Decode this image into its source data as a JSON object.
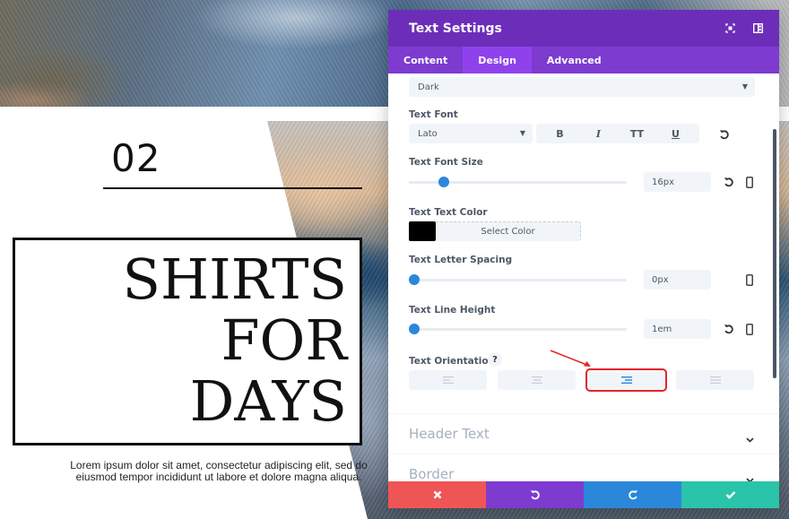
{
  "page": {
    "number": "02",
    "title_lines": [
      "SHIRTS",
      "FOR",
      "DAYS"
    ],
    "lorem_line1": "Lorem ipsum dolor sit amet, consectetur adipiscing elit, sed do",
    "lorem_line2": "eiusmod tempor incididunt ut labore et dolore magna aliqua."
  },
  "panel": {
    "title": "Text Settings",
    "header_icons": [
      "expand-icon",
      "split-view-icon"
    ],
    "tabs": [
      {
        "label": "Content",
        "active": false
      },
      {
        "label": "Design",
        "active": true
      },
      {
        "label": "Advanced",
        "active": false
      }
    ],
    "text_color_select": {
      "value": "Dark"
    },
    "text_font": {
      "label": "Text Font",
      "value": "Lato",
      "styles": [
        "B",
        "I",
        "TT",
        "U"
      ]
    },
    "text_font_size": {
      "label": "Text Font Size",
      "value": "16px",
      "slider_fraction": 0.16
    },
    "text_text_color": {
      "label": "Text Text Color",
      "swatch": "#000000",
      "button": "Select Color"
    },
    "text_letter_spacing": {
      "label": "Text Letter Spacing",
      "value": "0px",
      "slider_fraction": 0.0
    },
    "text_line_height": {
      "label": "Text Line Height",
      "value": "1em",
      "slider_fraction": 0.0
    },
    "text_orientation": {
      "label": "Text Orientation",
      "help": "?",
      "options": [
        "left",
        "center",
        "right",
        "justify"
      ],
      "selected": "right"
    },
    "sections": [
      {
        "title": "Header Text"
      },
      {
        "title": "Border"
      }
    ],
    "footer": {
      "cancel_color": "#ef5555",
      "undo_color": "#7e3bd0",
      "redo_color": "#2b87da",
      "save_color": "#29c4a9"
    }
  },
  "colors": {
    "header": "#6c2eb9",
    "tabs": "#7e3bd0",
    "active_tab": "#8f42ec",
    "accent": "#2b87da",
    "highlight": "#e5242a"
  }
}
